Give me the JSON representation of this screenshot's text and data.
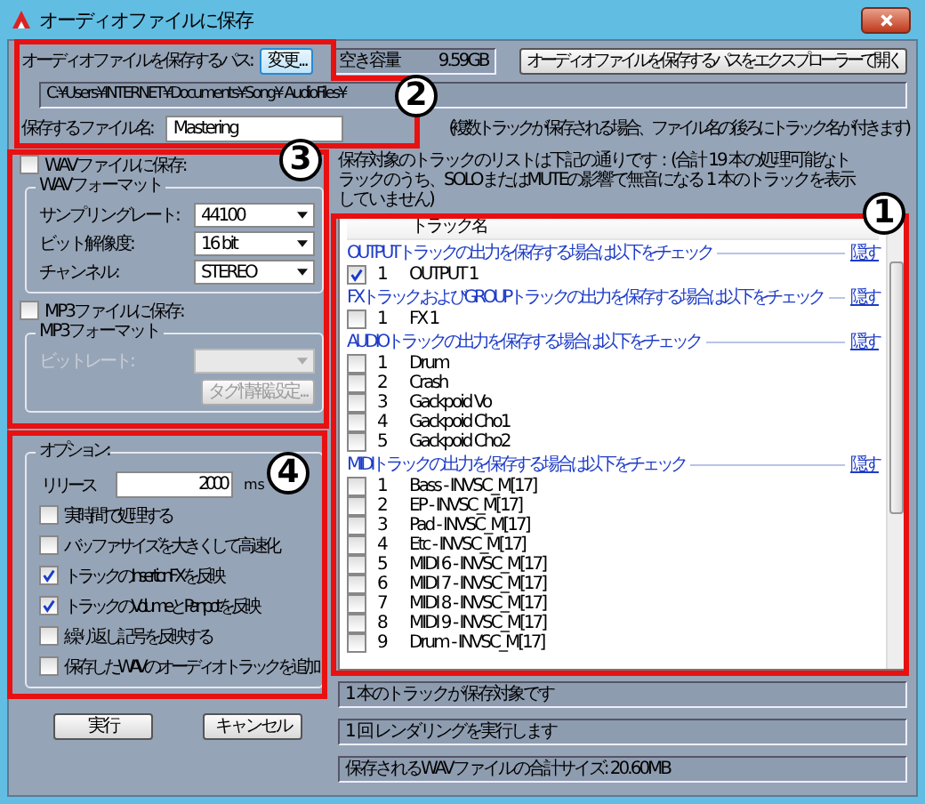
{
  "window": {
    "title": "オーディオファイルに保存"
  },
  "save_path": {
    "label": "オーディオファイルを保存するパス:",
    "change_button": "変更...",
    "free_space_label": "空き容量",
    "free_space_value": "9.59GB",
    "open_button": "オーディオファイルを保存するパスをエクスプローラーで開く",
    "path": "C:¥Users¥INTERNET¥Documents¥Song¥ AudioFiles¥"
  },
  "file_name": {
    "label": "保存するファイル名:",
    "value": "Mastering",
    "note": "(複数トラックが保存される場合、ファイル名の後ろにトラック名が付きます)"
  },
  "wav": {
    "label": "WAVファイルに保存:",
    "checked": false,
    "format_title": "WAVフォーマット",
    "fields": [
      {
        "label": "サンプリングレート:",
        "value": "44100"
      },
      {
        "label": "ビット解像度:",
        "value": "16 bit"
      },
      {
        "label": "チャンネル:",
        "value": "STEREO"
      }
    ]
  },
  "mp3": {
    "label": "MP3ファイルに保存:",
    "checked": false,
    "format_title": "MP3フォーマット",
    "bitrate_label": "ビットレート:",
    "tag_button": "タグ情報設定...",
    "disabled": true
  },
  "options": {
    "title": "オプション:",
    "release_label": "リリース",
    "release_value": "2000",
    "release_unit": "ms",
    "checkboxes": [
      {
        "label": "実時間で処理する",
        "checked": false
      },
      {
        "label": "バッファサイズを大きくして高速化",
        "checked": false
      },
      {
        "label": "トラックのInsertionFXを反映",
        "checked": true
      },
      {
        "label": "トラックのVolumeとPanpotを反映",
        "checked": true
      },
      {
        "label": "繰り返し記号を反映する",
        "checked": false
      },
      {
        "label": "保存したWAVのオーディオトラックを追加",
        "checked": false
      }
    ]
  },
  "track_list": {
    "description": "保存対象のトラックのリストは下記の通りです：(合計 19 本の処理可能なトラックのうち、SOLOまたはMUTEの影響で無音になる 1 本のトラックを表示していません)",
    "column": "トラック名",
    "groups": [
      {
        "title": "OUTPUTトラックの出力を保存する場合は以下をチェック",
        "hide_link": "隠す",
        "tracks": [
          {
            "number": "1",
            "name": "OUTPUT 1",
            "checked": true
          }
        ]
      },
      {
        "title": "FXトラック,およびGROUPトラックの出力を保存する場合は以下をチェック",
        "hide_link": "隠す",
        "tracks": [
          {
            "number": "1",
            "name": "FX 1",
            "checked": false
          }
        ]
      },
      {
        "title": "AUDIOトラックの出力を保存する場合は以下をチェック",
        "hide_link": "隠す",
        "tracks": [
          {
            "number": "1",
            "name": "Drum",
            "checked": false
          },
          {
            "number": "2",
            "name": "Crash",
            "checked": false
          },
          {
            "number": "3",
            "name": "Gackpoid Vo",
            "checked": false
          },
          {
            "number": "4",
            "name": "Gackpoid Cho1",
            "checked": false
          },
          {
            "number": "5",
            "name": "Gackpoid Cho2",
            "checked": false
          }
        ]
      },
      {
        "title": "MIDIトラックの出力を保存する場合は以下をチェック",
        "hide_link": "隠す",
        "tracks": [
          {
            "number": "1",
            "name": "Bass - INVSC_M[17]",
            "checked": false
          },
          {
            "number": "2",
            "name": "EP - INVSC_M[17]",
            "checked": false
          },
          {
            "number": "3",
            "name": "Pad - INVSC_M[17]",
            "checked": false
          },
          {
            "number": "4",
            "name": "Etc - INVSC_M[17]",
            "checked": false
          },
          {
            "number": "5",
            "name": "MIDI 6 - INVSC_M[17]",
            "checked": false
          },
          {
            "number": "6",
            "name": "MIDI 7 - INVSC_M[17]",
            "checked": false
          },
          {
            "number": "7",
            "name": "MIDI 8 - INVSC_M[17]",
            "checked": false
          },
          {
            "number": "8",
            "name": "MIDI 9 - INVSC_M[17]",
            "checked": false
          },
          {
            "number": "9",
            "name": "Drum - INVSC_M[17]",
            "checked": false
          }
        ]
      }
    ]
  },
  "status": [
    "1 本のトラックが保存対象です",
    "1 回 レンダリングを実行します",
    "保存されるWAVファイルの合計サイズ: 20.60MB"
  ],
  "buttons": [
    "実行",
    "キャンセル"
  ],
  "annotations": [
    {
      "number": "2"
    },
    {
      "number": "3"
    },
    {
      "number": "4"
    },
    {
      "number": "1"
    }
  ]
}
